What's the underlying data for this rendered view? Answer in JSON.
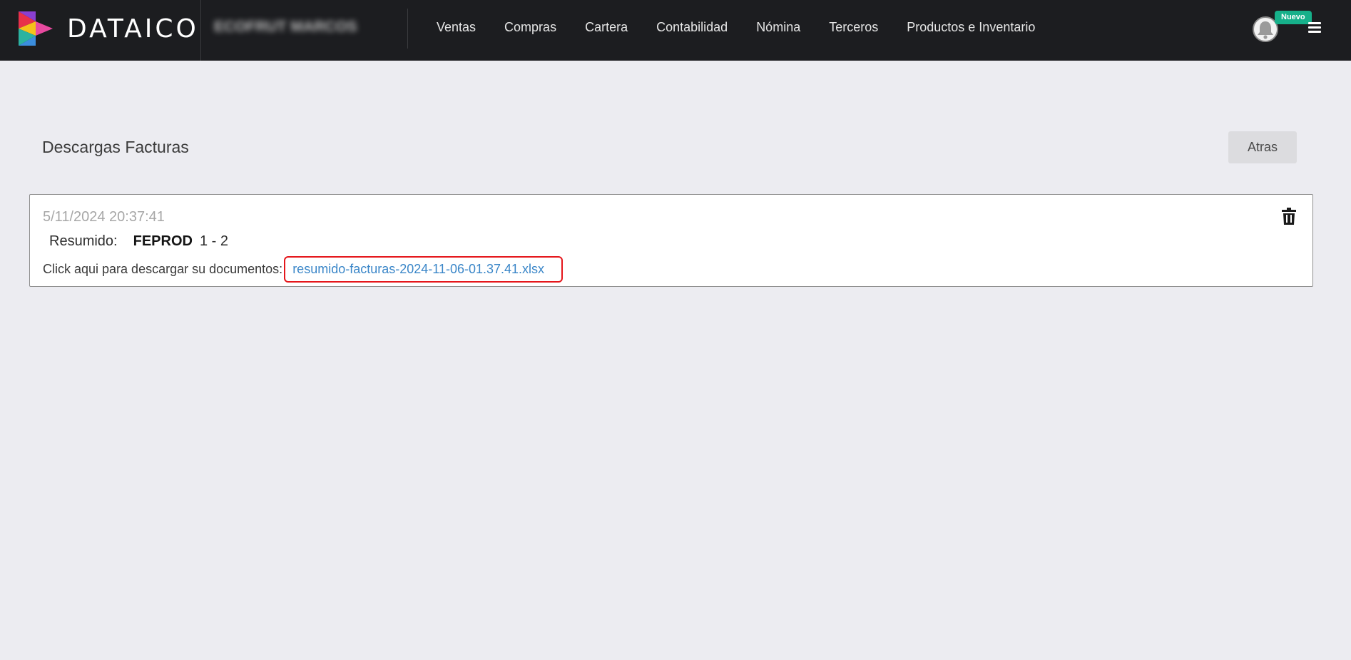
{
  "brand": {
    "name": "DATAICO",
    "company": "ECOFRUT MARCOS SAS"
  },
  "nav": {
    "items": [
      "Ventas",
      "Compras",
      "Cartera",
      "Contabilidad",
      "Nómina",
      "Terceros",
      "Productos e Inventario"
    ]
  },
  "header": {
    "badge": "Nuevo"
  },
  "page": {
    "title": "Descargas Facturas",
    "back_label": "Atras"
  },
  "download": {
    "date": "5/11/2024 20:37:41",
    "summary_label": "Resumido:",
    "prefix": "FEPROD",
    "range": "1 - 2",
    "instruction": "Click aqui para descargar su documentos:",
    "file_name": "resumido-facturas-2024-11-06-01.37.41.xlsx"
  },
  "colors": {
    "navbar": "#1c1d20",
    "link": "#3a86c8",
    "highlight": "#e5161b",
    "badge": "#16b08a"
  }
}
